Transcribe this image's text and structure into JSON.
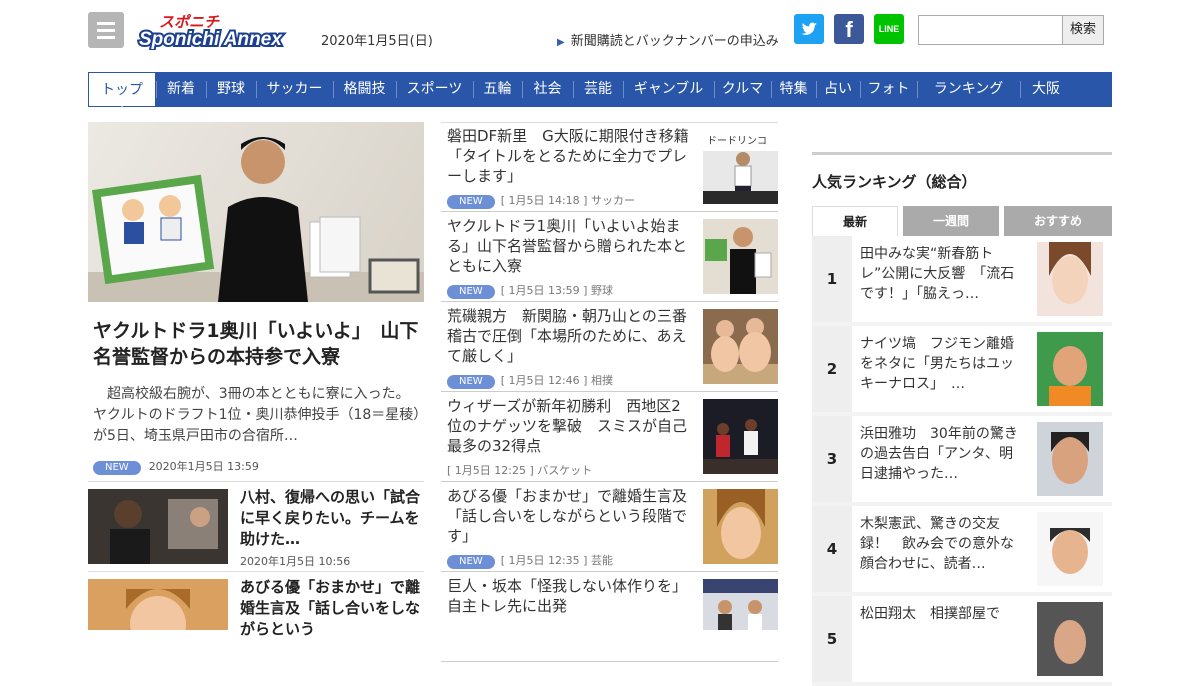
{
  "header": {
    "logo_text": "スポニチ Sponichi Annex",
    "date": "2020年1月5日(日)",
    "subscribe_link": "新聞購読とバックナンバーの申込み",
    "line_label": "LINE",
    "search_button": "検索",
    "search_value": ""
  },
  "nav": {
    "items": [
      "トップ",
      "新着",
      "野球",
      "サッカー",
      "格闘技",
      "スポーツ",
      "五輪",
      "社会",
      "芸能",
      "ギャンブル",
      "クルマ",
      "特集",
      "占い",
      "フォト",
      "ランキング",
      "大阪"
    ]
  },
  "hero": {
    "title": "ヤクルトドラ1奥川「いよいよ」　山下名誉監督からの本持参で入寮",
    "lead": "　超高校級右腕が、3冊の本とともに寮に入った。ヤクルトのドラフト1位・奥川恭伸投手（18＝星稜）が5日、埼玉県戸田市の合宿所…",
    "badge": "NEW",
    "time": "2020年1月5日 13:59"
  },
  "small_articles": [
    {
      "title": "八村、復帰への思い「試合に早く戻りたい。チームを助けた…",
      "time": "2020年1月5日 10:56"
    },
    {
      "title": "あびる優「おまかせ」で離婚生言及「話し合いをしながらという",
      "time": ""
    }
  ],
  "articles": [
    {
      "title": "磐田DF新里　G大阪に期限付き移籍「タイトルをとるために全力でプレーします」",
      "badge": "NEW",
      "meta": "[ 1月5日 14:18 ] サッカー"
    },
    {
      "title": "ヤクルトドラ1奥川「いよいよ始まる」山下名誉監督から贈られた本とともに入寮",
      "badge": "NEW",
      "meta": "[ 1月5日 13:59 ] 野球"
    },
    {
      "title": "荒磯親方　新関脇・朝乃山との三番稽古で圧倒「本場所のために、あえて厳しく」",
      "badge": "NEW",
      "meta": "[ 1月5日 12:46 ] 相撲"
    },
    {
      "title": "ウィザーズが新年初勝利　西地区2位のナゲッツを撃破　スミスが自己最多の32得点",
      "badge": "",
      "meta": "[ 1月5日 12:25 ] バスケット"
    },
    {
      "title": "あびる優「おまかせ」で離婚生言及「話し合いをしながらという段階です」",
      "badge": "NEW",
      "meta": "[ 1月5日 12:35 ] 芸能"
    },
    {
      "title": "巨人・坂本「怪我しない体作りを」自主トレ先に出発",
      "badge": "",
      "meta": ""
    }
  ],
  "ranking": {
    "heading": "人気ランキング（総合）",
    "tabs": [
      "最新",
      "一週間",
      "おすすめ"
    ],
    "items": [
      {
        "rank": "1",
        "title": "田中みな実“新春筋トレ”公開に大反響　「流石です！」「脇えっ…"
      },
      {
        "rank": "2",
        "title": "ナイツ塙　フジモン離婚をネタに「男たちはユッキーナロス」　…"
      },
      {
        "rank": "3",
        "title": "浜田雅功　30年前の驚きの過去告白「アンタ、明日逮捕やった…"
      },
      {
        "rank": "4",
        "title": "木梨憲武、驚きの交友録！　飲み会での意外な顔合わせに、読者…"
      },
      {
        "rank": "5",
        "title": "松田翔太　相撲部屋で"
      }
    ]
  },
  "colors": {
    "nav_bg": "#2956a8",
    "badge": "#6d8fd6",
    "logo_red": "#d8191f"
  }
}
